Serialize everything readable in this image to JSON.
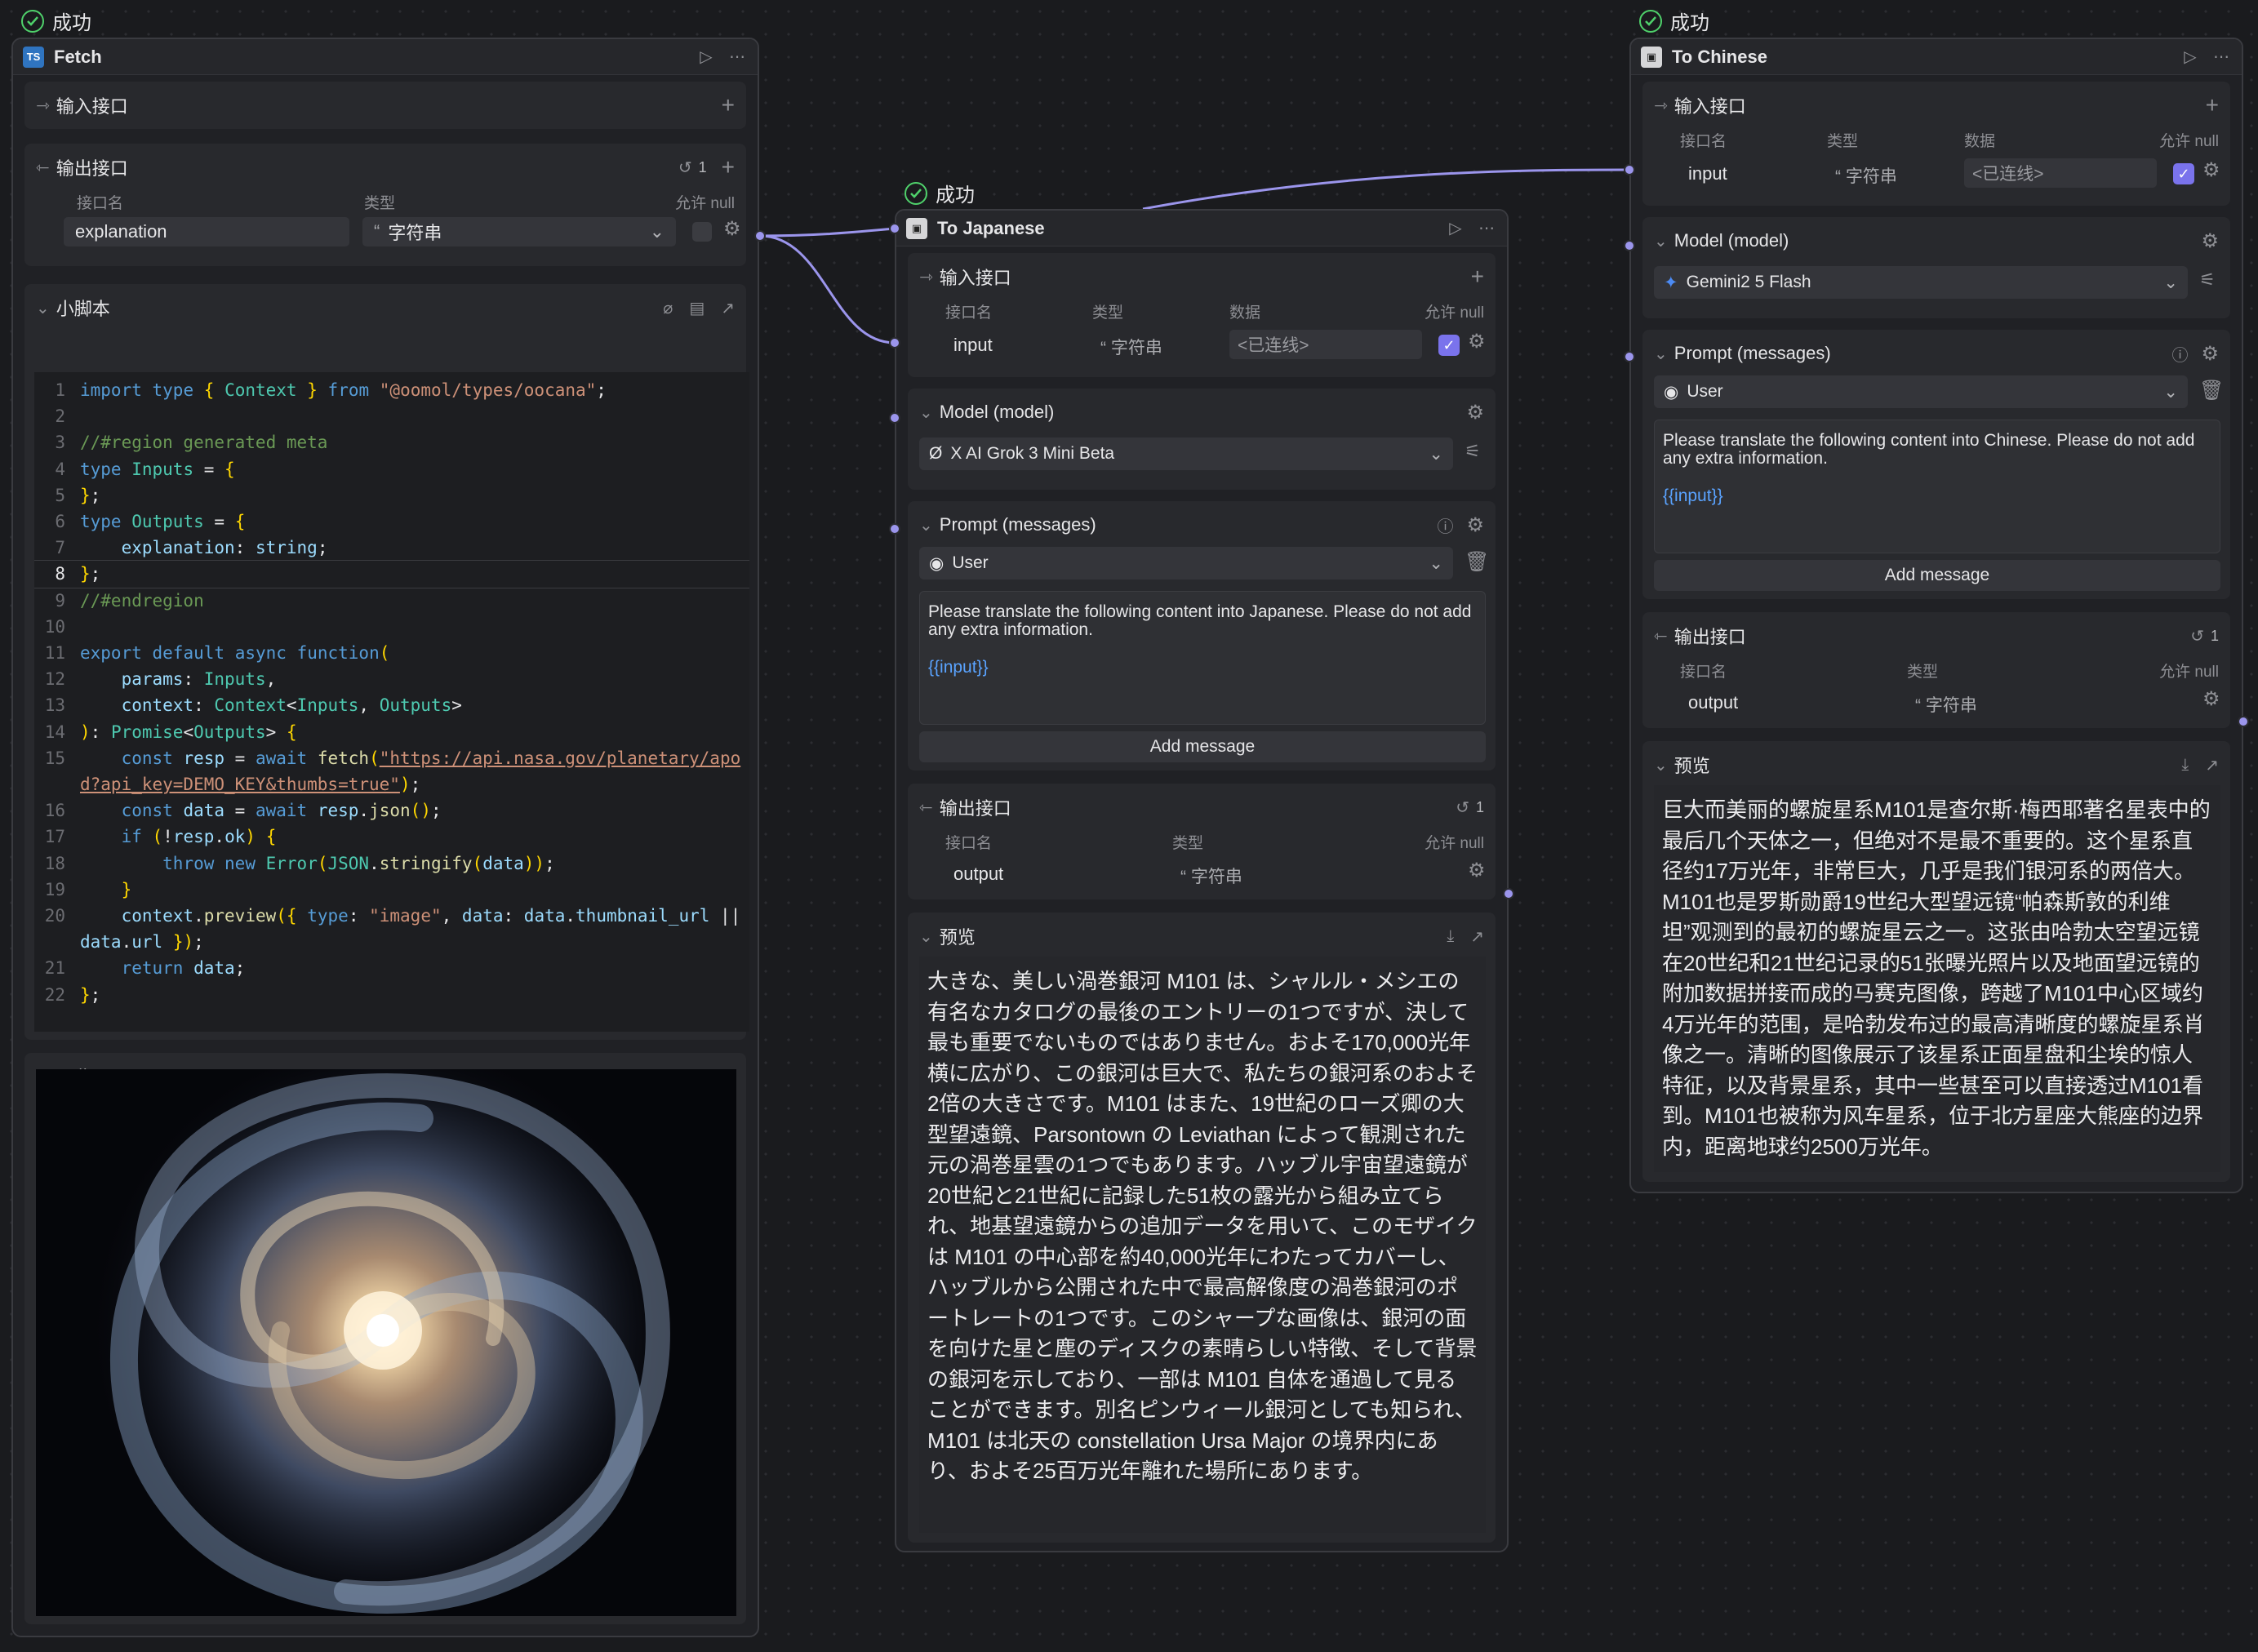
{
  "status": {
    "success": "成功"
  },
  "fetch_node": {
    "title": "Fetch",
    "badge": "TS",
    "input_section": "输入接口",
    "output_section": "输出接口",
    "output_count": "1",
    "col_name": "接口名",
    "col_type": "类型",
    "col_null": "允许 null",
    "output_name": "explanation",
    "output_type": "字符串",
    "script_section": "小脚本",
    "preview_section": "预览"
  },
  "code_lines": [
    "import type { Context } from \"@oomol/types/oocana\";",
    "",
    "//#region generated meta",
    "type Inputs = {",
    "};",
    "type Outputs = {",
    "    explanation: string;",
    "};",
    "//#endregion",
    "",
    "export default async function(",
    "    params: Inputs,",
    "    context: Context<Inputs, Outputs>",
    "): Promise<Outputs> {",
    "    const resp = await fetch(\"https://api.nasa.gov/planetary/apod?api_key=DEMO_KEY&thumbs=true\");",
    "    const data = await resp.json();",
    "    if (!resp.ok) {",
    "        throw new Error(JSON.stringify(data));",
    "    }",
    "    context.preview({ type: \"image\", data: data.thumbnail_url || data.url });",
    "    return data;",
    "};"
  ],
  "japanese_node": {
    "title": "To Japanese",
    "input_section": "输入接口",
    "col_name": "接口名",
    "col_type": "类型",
    "col_data": "数据",
    "col_null": "允许 null",
    "input_name": "input",
    "input_type": "字符串",
    "input_data": "<已连线>",
    "model_section": "Model (model)",
    "model_value": "X AI Grok 3 Mini Beta",
    "prompt_section": "Prompt (messages)",
    "role": "User",
    "message": "Please translate the following content into Japanese. Please do not add any extra information.",
    "message_var": "{{input}}",
    "add_message": "Add message",
    "output_section": "输出接口",
    "output_count": "1",
    "output_name": "output",
    "output_type": "字符串",
    "preview_section": "预览",
    "preview_text": "大きな、美しい渦巻銀河 M101 は、シャルル・メシエの有名なカタログの最後のエントリーの1つですが、決して最も重要でないものではありません。およそ170,000光年横に広がり、この銀河は巨大で、私たちの銀河系のおよそ2倍の大きさです。M101 はまた、19世紀のローズ卿の大型望遠鏡、Parsontown の Leviathan によって観測された元の渦巻星雲の1つでもあります。ハッブル宇宙望遠鏡が20世紀と21世紀に記録した51枚の露光から組み立てられ、地基望遠鏡からの追加データを用いて、このモザイクは M101 の中心部を約40,000光年にわたってカバーし、ハッブルから公開された中で最高解像度の渦巻銀河のポートレートの1つです。このシャープな画像は、銀河の面を向けた星と塵のディスクの素晴らしい特徴、そして背景の銀河を示しており、一部は M101 自体を通過して見ることができます。別名ピンウィール銀河としても知られ、M101 は北天の constellation Ursa Major の境界内にあり、およそ25百万光年離れた場所にあります。"
  },
  "chinese_node": {
    "title": "To Chinese",
    "input_section": "输入接口",
    "col_name": "接口名",
    "col_type": "类型",
    "col_data": "数据",
    "col_null": "允许 null",
    "input_name": "input",
    "input_type": "字符串",
    "input_data": "<已连线>",
    "model_section": "Model (model)",
    "model_value": "Gemini2 5 Flash",
    "prompt_section": "Prompt (messages)",
    "role": "User",
    "message": "Please translate the following content into Chinese. Please do not add any extra information.",
    "message_var": "{{input}}",
    "add_message": "Add message",
    "output_section": "输出接口",
    "output_count": "1",
    "output_name": "output",
    "output_type": "字符串",
    "preview_section": "预览",
    "preview_text": "巨大而美丽的螺旋星系M101是查尔斯·梅西耶著名星表中的最后几个天体之一，但绝对不是最不重要的。这个星系直径约17万光年，非常巨大，几乎是我们银河系的两倍大。M101也是罗斯勋爵19世纪大型望远镜“帕森斯敦的利维坦”观测到的最初的螺旋星云之一。这张由哈勃太空望远镜在20世纪和21世纪记录的51张曝光照片以及地面望远镜的附加数据拼接而成的马赛克图像，跨越了M101中心区域约4万光年的范围，是哈勃发布过的最高清晰度的螺旋星系肖像之一。清晰的图像展示了该星系正面星盘和尘埃的惊人特征，以及背景星系，其中一些甚至可以直接透过M101看到。M101也被称为风车星系，位于北方星座大熊座的边界内，距离地球约2500万光年。"
  }
}
